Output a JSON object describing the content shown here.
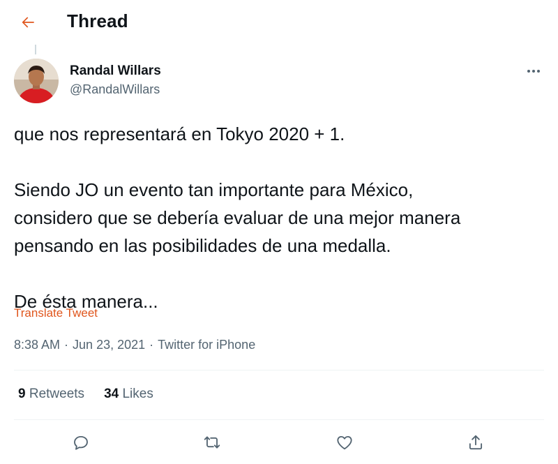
{
  "header": {
    "title": "Thread",
    "back_icon": "arrow-left-icon",
    "accent_color": "#e0561d"
  },
  "author": {
    "display_name": "Randal Willars",
    "handle": "@RandalWillars",
    "avatar_icon": "user-avatar"
  },
  "tweet": {
    "lines": [
      "que nos representará en Tokyo 2020 + 1.",
      "Siendo JO un evento tan importante para México,",
      "considero que se debería evaluar de una mejor manera",
      "pensando en las posibilidades de una medalla.",
      "De ésta manera..."
    ],
    "translate_label": "Translate Tweet",
    "time": "8:38 AM",
    "date": "Jun 23, 2021",
    "source": "Twitter for iPhone",
    "separator": "·"
  },
  "stats": {
    "retweets_count": "9",
    "retweets_label": "Retweets",
    "likes_count": "34",
    "likes_label": "Likes"
  },
  "actions": {
    "reply_icon": "reply-icon",
    "retweet_icon": "retweet-icon",
    "like_icon": "heart-icon",
    "share_icon": "share-icon"
  },
  "colors": {
    "text_primary": "#0f1419",
    "text_secondary": "#536471",
    "accent": "#e0561d",
    "divider": "#eff3f4"
  }
}
